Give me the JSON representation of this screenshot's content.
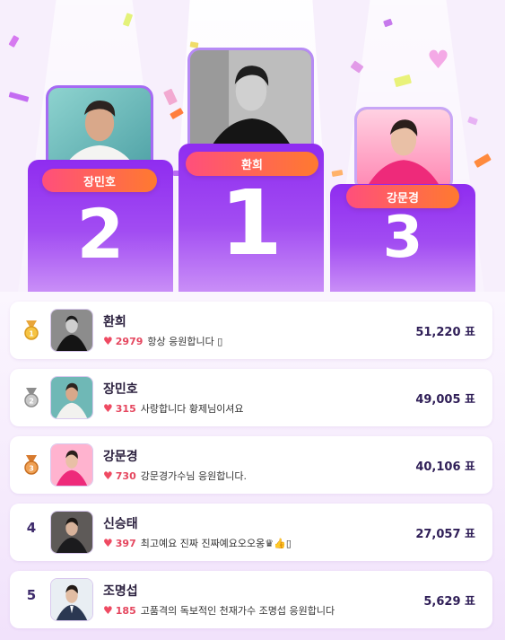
{
  "podium": {
    "first": {
      "name": "환희",
      "rank": "1"
    },
    "second": {
      "name": "장민호",
      "rank": "2"
    },
    "third": {
      "name": "강문경",
      "rank": "3"
    }
  },
  "ranking": [
    {
      "rank": "1",
      "badge": "gold-medal-icon",
      "name": "환희",
      "hearts": "2979",
      "message": "항상 응원합니다 ▯",
      "votes": "51,220 표"
    },
    {
      "rank": "2",
      "badge": "silver-medal-icon",
      "name": "장민호",
      "hearts": "315",
      "message": "사랑합니다 황제님이셔요",
      "votes": "49,005 표"
    },
    {
      "rank": "3",
      "badge": "bronze-medal-icon",
      "name": "강문경",
      "hearts": "730",
      "message": "강문경가수님 응원합니다.",
      "votes": "40,106 표"
    },
    {
      "rank": "4",
      "name": "신승태",
      "hearts": "397",
      "message": "최고예요 진짜 진짜예요오오옹♛👍▯",
      "votes": "27,057 표"
    },
    {
      "rank": "5",
      "name": "조명섭",
      "hearts": "185",
      "message": "고품격의 독보적인 천재가수 조명섭 응원합니다",
      "votes": "5,629 표"
    }
  ],
  "colors": {
    "podium_purple": "#8f2cf0",
    "name_tag_start": "#ff4f7c",
    "name_tag_end": "#ff7a2f",
    "heart": "#ef4a62",
    "vote_text": "#2f1e57"
  }
}
